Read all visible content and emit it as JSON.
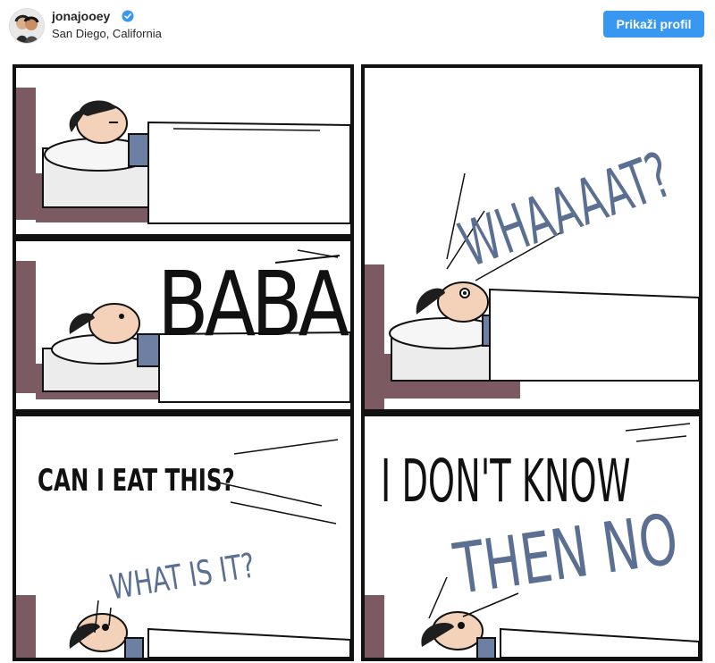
{
  "post_header": {
    "username": "jonajooey",
    "location": "San Diego, California",
    "profile_button_label": "Prikaži profil",
    "verified_icon": "verified-badge-icon",
    "accent_color": "#3897f0"
  },
  "comic": {
    "panel2_text": "BABA",
    "panel3_text": "WHAAAAT?",
    "panel4_text_top": "CAN I EAT THIS?",
    "panel4_text_bottom": "WHAT IS IT?",
    "panel5_text_top": "I DON'T KNOW",
    "panel5_text_bottom": "THEN NO",
    "reply_color": "#5a6f91"
  }
}
